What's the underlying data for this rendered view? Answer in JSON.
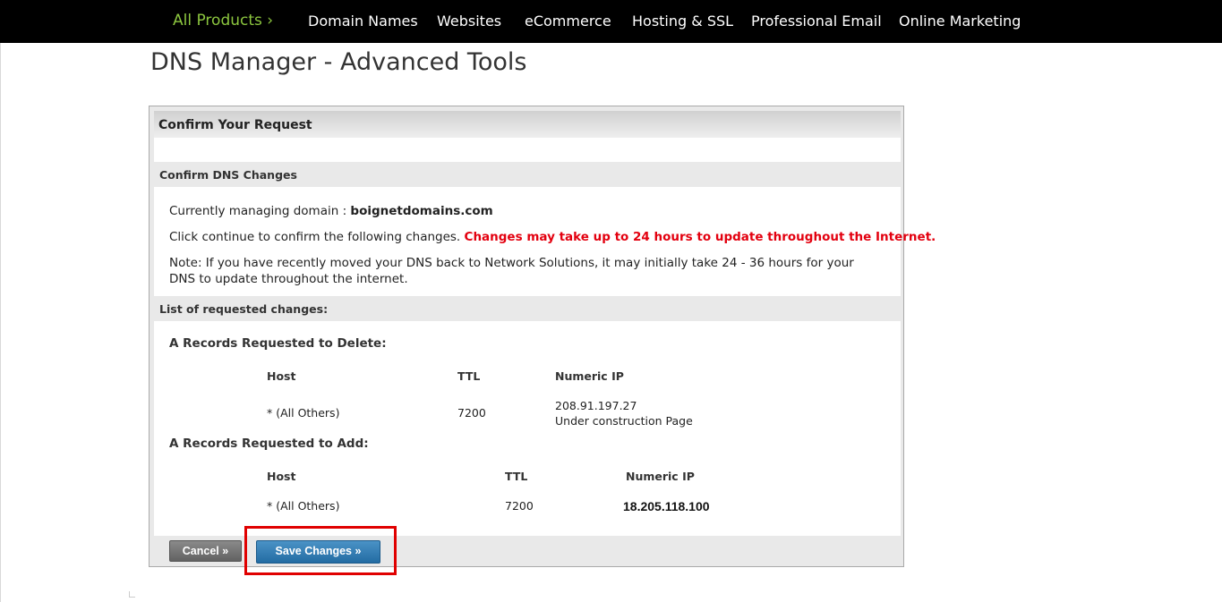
{
  "topnav": {
    "items": [
      {
        "label": "All Products ›"
      },
      {
        "label": "Domain Names"
      },
      {
        "label": "Websites"
      },
      {
        "label": "eCommerce"
      },
      {
        "label": "Hosting & SSL"
      },
      {
        "label": "Professional Email"
      },
      {
        "label": "Online Marketing"
      }
    ],
    "accent_color": "#8cc63f"
  },
  "page_title": "DNS Manager - Advanced Tools",
  "panel": {
    "title": "Confirm Your Request",
    "confirm_section": {
      "heading": "Confirm DNS Changes",
      "managing_label": "Currently managing domain : ",
      "domain": "boignetdomains.com",
      "continue_text": "Click continue to confirm the following changes. ",
      "warning": "Changes may take up to 24 hours to update throughout the Internet.",
      "note": "Note: If you have recently moved your DNS back to Network Solutions, it may initially take 24 - 36 hours for your DNS to update throughout the internet."
    },
    "changes_section": {
      "heading": "List of requested changes:",
      "delete": {
        "heading": "A Records Requested to Delete:",
        "columns": [
          "Host",
          "TTL",
          "Numeric IP"
        ],
        "rows": [
          {
            "host": "* (All Others)",
            "ttl": "7200",
            "ip": "208.91.197.27",
            "ip_note": "Under construction Page"
          }
        ]
      },
      "add": {
        "heading": "A Records Requested to Add:",
        "columns": [
          "Host",
          "TTL",
          "Numeric IP"
        ],
        "rows": [
          {
            "host": "* (All Others)",
            "ttl": "7200",
            "ip": "18.205.118.100"
          }
        ]
      }
    },
    "buttons": {
      "cancel": "Cancel »",
      "save": "Save Changes »"
    }
  },
  "colors": {
    "warning": "#e3000f",
    "save_button": "#2f7db5",
    "highlight_box": "#e00000"
  }
}
